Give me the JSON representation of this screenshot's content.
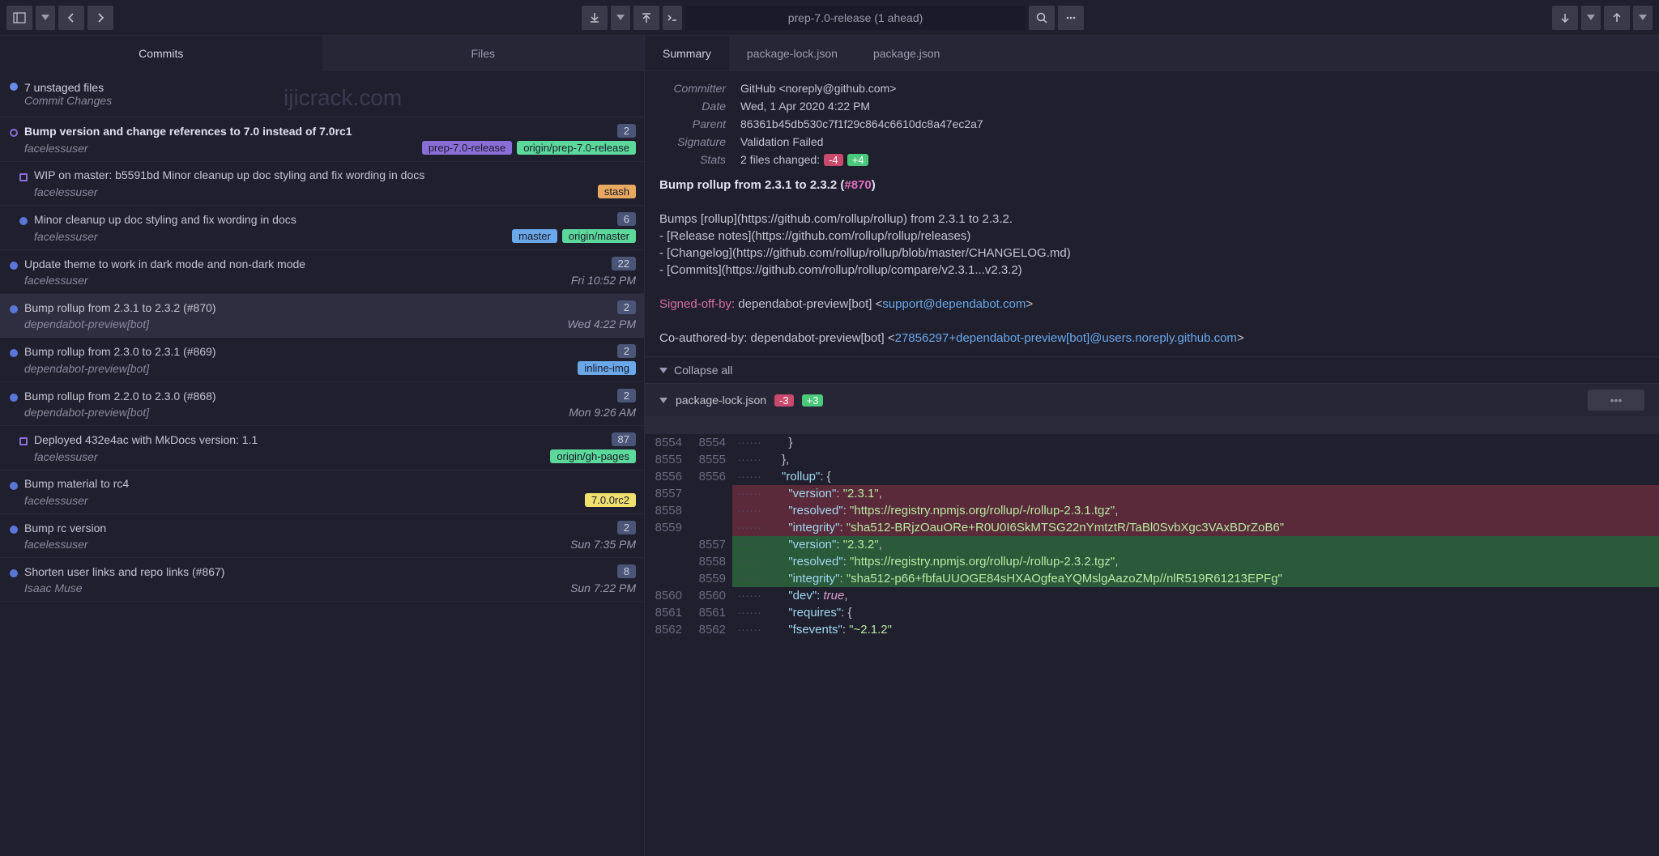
{
  "watermark": "ijicrack.com",
  "branch": "prep-7.0-release (1 ahead)",
  "left_tabs": [
    "Commits",
    "Files"
  ],
  "uncommitted": {
    "title": "7 unstaged files",
    "sub": "Commit Changes"
  },
  "commits": [
    {
      "title": "Bump version and change references to 7.0 instead of 7.0rc1",
      "author": "facelessuser",
      "count": "2",
      "tags": [
        {
          "label": "prep-7.0-release",
          "cls": "pill-purple"
        },
        {
          "label": "origin/prep-7.0-release",
          "cls": "pill-green"
        }
      ],
      "bold": true,
      "dot": "hollow"
    },
    {
      "title": "WIP on master: b5591bd Minor cleanup up doc styling and fix wording in docs",
      "author": "facelessuser",
      "tags": [
        {
          "label": "stash",
          "cls": "pill-orange"
        }
      ],
      "dot": "square",
      "indent": true
    },
    {
      "title": "Minor cleanup up doc styling and fix wording in docs",
      "author": "facelessuser",
      "count": "6",
      "tags": [
        {
          "label": "master",
          "cls": "pill-blue"
        },
        {
          "label": "origin/master",
          "cls": "pill-green"
        }
      ],
      "dot": "solid",
      "indent": true
    },
    {
      "title": "Update theme to work in dark mode and non-dark mode",
      "author": "facelessuser",
      "count": "22",
      "time": "Fri 10:52 PM",
      "dot": "solid"
    },
    {
      "title": "Bump rollup from 2.3.1 to 2.3.2 (#870)",
      "author": "dependabot-preview[bot]",
      "count": "2",
      "time": "Wed 4:22 PM",
      "selected": true,
      "dot": "solid"
    },
    {
      "title": "Bump rollup from 2.3.0 to 2.3.1 (#869)",
      "author": "dependabot-preview[bot]",
      "count": "2",
      "tags": [
        {
          "label": "inline-img",
          "cls": "pill-blue"
        }
      ],
      "dot": "solid"
    },
    {
      "title": "Bump rollup from 2.2.0 to 2.3.0 (#868)",
      "author": "dependabot-preview[bot]",
      "count": "2",
      "time": "Mon 9:26 AM",
      "dot": "solid"
    },
    {
      "title": "Deployed 432e4ac with MkDocs version: 1.1",
      "author": "facelessuser",
      "count": "87",
      "tags": [
        {
          "label": "origin/gh-pages",
          "cls": "pill-green"
        }
      ],
      "dot": "square",
      "indent": true
    },
    {
      "title": "Bump material to rc4",
      "author": "facelessuser",
      "tags": [
        {
          "label": "7.0.0rc2",
          "cls": "pill-yellow"
        }
      ],
      "dot": "solid"
    },
    {
      "title": "Bump rc version",
      "author": "facelessuser",
      "count": "2",
      "time": "Sun 7:35 PM",
      "dot": "solid"
    },
    {
      "title": "Shorten user links and repo links (#867)",
      "author": "Isaac Muse",
      "count": "8",
      "time": "Sun 7:22 PM",
      "dot": "solid"
    }
  ],
  "right_tabs": [
    "Summary",
    "package-lock.json",
    "package.json"
  ],
  "meta": {
    "committer": "GitHub <noreply@github.com>",
    "date": "Wed, 1 Apr 2020 4:22 PM",
    "parent": "86361b45db530c7f1f29c864c6610dc8a47ec2a7",
    "signature": "Validation Failed",
    "stats_label": "2 files changed:",
    "stats_minus": "-4",
    "stats_plus": "+4"
  },
  "meta_labels": {
    "committer": "Committer",
    "date": "Date",
    "parent": "Parent",
    "signature": "Signature",
    "stats": "Stats"
  },
  "commit_msg": {
    "title_pre": "Bump rollup from 2.3.1 to 2.3.2 (",
    "title_pr": "#870",
    "title_post": ")",
    "body_l1": "Bumps [rollup](https://github.com/rollup/rollup) from 2.3.1 to 2.3.2.",
    "body_l2": "- [Release notes](https://github.com/rollup/rollup/releases)",
    "body_l3": "- [Changelog](https://github.com/rollup/rollup/blob/master/CHANGELOG.md)",
    "body_l4": "- [Commits](https://github.com/rollup/rollup/compare/v2.3.1...v2.3.2)",
    "signed": "Signed-off-by:",
    "signed_val": " dependabot-preview[bot] <",
    "signed_link": "support@dependabot.com",
    "coauth": "Co-authored-by: dependabot-preview[bot] <",
    "coauth_link": "27856297+dependabot-preview[bot]@users.noreply.github.com",
    "gt": ">"
  },
  "collapse": "Collapse all",
  "file": {
    "name": "package-lock.json",
    "minus": "-3",
    "plus": "+3"
  },
  "code_lines": [
    {
      "a": "8554",
      "b": "8554",
      "t": "ctx",
      "content": "        }"
    },
    {
      "a": "8555",
      "b": "8555",
      "t": "ctx",
      "content": "      },"
    },
    {
      "a": "8556",
      "b": "8556",
      "t": "ctx",
      "key": "rollup",
      "post": ": {"
    },
    {
      "a": "8557",
      "b": "",
      "t": "del",
      "key": "version",
      "val": "2.3.1",
      "post": ","
    },
    {
      "a": "8558",
      "b": "",
      "t": "del",
      "key": "resolved",
      "val": "https://registry.npmjs.org/rollup/-/rollup-2.3.1.tgz",
      "post": ","
    },
    {
      "a": "8559",
      "b": "",
      "t": "del",
      "key": "integrity",
      "val": "sha512-BRjzOauORe+R0U0I6SkMTSG22nYmtztR/TaBl0SvbXgc3VAxBDrZoB6"
    },
    {
      "a": "",
      "b": "8557",
      "t": "add",
      "key": "version",
      "val": "2.3.2",
      "post": ","
    },
    {
      "a": "",
      "b": "8558",
      "t": "add",
      "key": "resolved",
      "val": "https://registry.npmjs.org/rollup/-/rollup-2.3.2.tgz",
      "post": ","
    },
    {
      "a": "",
      "b": "8559",
      "t": "add",
      "key": "integrity",
      "val": "sha512-p66+fbfaUUOGE84sHXAOgfeaYQMslgAazoZMp//nlR519R61213EPFg"
    },
    {
      "a": "8560",
      "b": "8560",
      "t": "ctx",
      "key": "dev",
      "bool": "true",
      "post": ","
    },
    {
      "a": "8561",
      "b": "8561",
      "t": "ctx",
      "key": "requires",
      "post": ": {"
    },
    {
      "a": "8562",
      "b": "8562",
      "t": "ctx",
      "key": "fsevents",
      "val": "~2.1.2"
    }
  ]
}
